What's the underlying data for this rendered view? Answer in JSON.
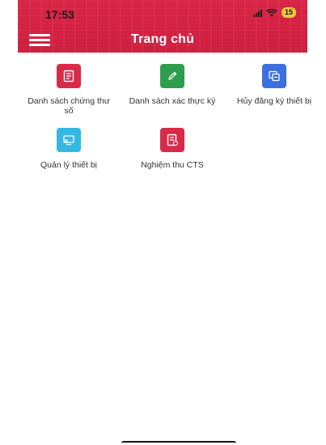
{
  "status_bar": {
    "time": "17:53",
    "battery": "15"
  },
  "header": {
    "title": "Trang chủ",
    "menu_icon": "hamburger-menu-icon",
    "background": "#d92546"
  },
  "tiles": [
    {
      "label": "Danh sách chứng thư số",
      "icon": "document-list-icon",
      "color": "#d92a4a"
    },
    {
      "label": "Danh sách xác thực ký",
      "icon": "pencil-icon",
      "color": "#2e9e4c"
    },
    {
      "label": "Hủy đăng ký thiết bị",
      "icon": "device-copy-icon",
      "color": "#3c6fe0"
    },
    {
      "label": "Quản lý thiết bị",
      "icon": "device-manage-icon",
      "color": "#35b9e4"
    },
    {
      "label": "Nghiệm thu CTS",
      "icon": "acceptance-document-icon",
      "color": "#d92a4a"
    }
  ]
}
